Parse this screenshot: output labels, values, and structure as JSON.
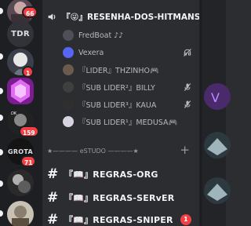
{
  "servers": [
    {
      "name": "server-1",
      "badge": "66"
    },
    {
      "name": "server-tdr",
      "label": "TDR"
    },
    {
      "name": "server-3",
      "badge": "1"
    },
    {
      "name": "server-4"
    },
    {
      "name": "server-5",
      "badge": "159"
    },
    {
      "name": "server-grota",
      "label": "GROTA",
      "badge": "71"
    },
    {
      "name": "server-7"
    }
  ],
  "voice": {
    "channel_name": "『😜』RESENHA-DOS-HITMANS",
    "members": [
      {
        "name": "FredBoat ♪♪",
        "status_icon": "none"
      },
      {
        "name": "Vexera",
        "status_icon": "deafened-icon"
      },
      {
        "name": "『LIDER』THZINHO🎮",
        "status_icon": "none"
      },
      {
        "name": "『SUB LIDER²』BILLY",
        "status_icon": "muted-icon"
      },
      {
        "name": "『SUB LIDER³』KAUA",
        "status_icon": "muted-icon"
      },
      {
        "name": "『SUB LIDER¹』MEDUSA🎮",
        "status_icon": "none"
      }
    ]
  },
  "category": {
    "label": "★———— eSTUDO ————★",
    "plus": "+"
  },
  "text_channels": [
    {
      "name": "『📖』REGRAS-ORG"
    },
    {
      "name": "『📖』REGRAS-SERvER"
    },
    {
      "name": "『📖』REGRAS-SNIPER",
      "badge": "1"
    }
  ],
  "colors": {
    "accent_red": "#f23f43",
    "bg": "#2b2d31",
    "rail": "#1e1f22"
  }
}
